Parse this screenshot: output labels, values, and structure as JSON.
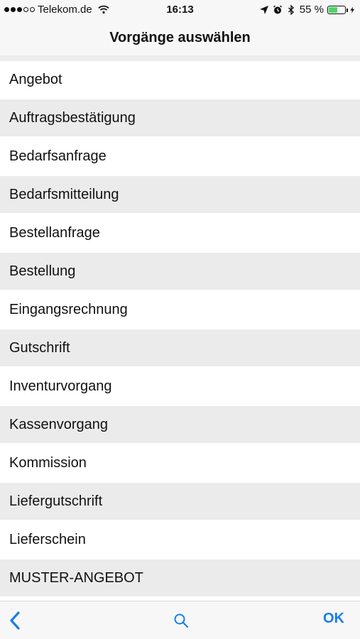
{
  "status_bar": {
    "carrier": "Telekom.de",
    "time": "16:13",
    "battery_percent": "55 %",
    "battery_level": 0.55
  },
  "nav": {
    "title": "Vorgänge auswählen"
  },
  "list": {
    "items": [
      "Angebot",
      "Auftragsbestätigung",
      "Bedarfsanfrage",
      "Bedarfsmitteilung",
      "Bestellanfrage",
      "Bestellung",
      "Eingangsrechnung",
      "Gutschrift",
      "Inventurvorgang",
      "Kassenvorgang",
      "Kommission",
      "Liefergutschrift",
      "Lieferschein",
      "MUSTER-ANGEBOT"
    ]
  },
  "toolbar": {
    "back_icon": "chevron-left-icon",
    "search_icon": "search-icon",
    "ok_label": "OK"
  },
  "colors": {
    "accent": "#1a7de8",
    "row_alt": "#ebebeb",
    "battery": "#4cd964"
  }
}
